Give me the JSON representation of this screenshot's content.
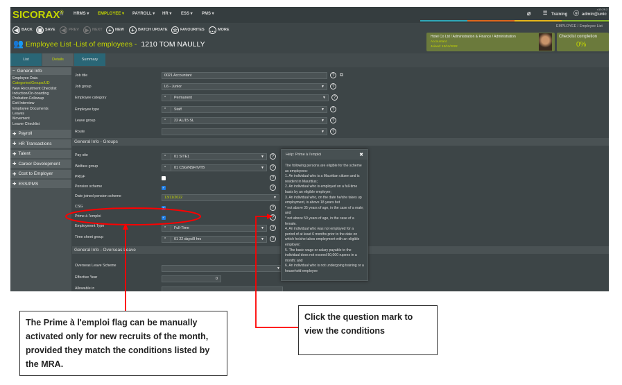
{
  "app": {
    "logo": "SICORAX",
    "version": "v10.29.2",
    "user": "admin@unic",
    "training": "Training"
  },
  "nav": [
    "HRMS ▾",
    "EMPLOYEE ▾",
    "PAYROLL ▾",
    "HR ▾",
    "ESS ▾",
    "PMS ▾"
  ],
  "toolbar": {
    "back": "BACK",
    "save": "SAVE",
    "prev": "PREV",
    "next": "NEXT",
    "new": "NEW",
    "batch": "BATCH UPDATE",
    "fav": "FAVOURITES",
    "more": "MORE"
  },
  "breadcrumb": {
    "section": "EMPLOYEE /",
    "page": "Employee List"
  },
  "page_title": "Employee List -List of employees -",
  "employee": "1210 TOM NAULLY",
  "card": {
    "org": "Hotel Co Ltd / Administration & Finance / Administration",
    "position": "Accountant",
    "joined": "Joined: 13/11/2022",
    "checklist_label": "Checklist completion",
    "checklist_value": "0%"
  },
  "stripe_colors": [
    "#2fa8b8",
    "#e0661c",
    "#e8b81a",
    "#8cba2a"
  ],
  "tabs": [
    "List",
    "Details",
    "Summary"
  ],
  "sidebar": {
    "general": "General Info",
    "items": [
      "Employee Data",
      "Categories/Groups/UD",
      "New Recruitment Checklist",
      "Induction/On-boarding",
      "Probation Followup",
      "Exit Interview",
      "Employee Documents",
      "Leaves",
      "Movement",
      "Leaver Checklist"
    ],
    "groups": [
      "Payroll",
      "HR Transactions",
      "Talent",
      "Career Development",
      "Cost to Employer",
      "ESS/PMS"
    ]
  },
  "form": {
    "rows1": [
      {
        "label": "Job title",
        "value": "0021 Accountant"
      },
      {
        "label": "Job group",
        "value": "L6 - Junior"
      },
      {
        "label": "Employee category",
        "value": "Permanent"
      },
      {
        "label": "Employee type",
        "value": "Staff"
      },
      {
        "label": "Leave group",
        "value": "22 AL/15 SL"
      },
      {
        "label": "Route",
        "value": ""
      }
    ],
    "section_groups": "General Info - Groups",
    "pay_site": {
      "label": "Pay site",
      "value": "01 SITE1"
    },
    "welfare": {
      "label": "Welfare group",
      "value": "01 CSG/NSF/IVTB"
    },
    "prgf": {
      "label": "PRGF",
      "checked": false
    },
    "pension": {
      "label": "Pension scheme",
      "checked": true
    },
    "date_pension": {
      "label": "Date joined pension scheme",
      "value": "13/11/2022"
    },
    "csg": {
      "label": "CSG",
      "checked": true
    },
    "prime": {
      "label": "Prime à l'emploi",
      "checked": true
    },
    "emp_type": {
      "label": "Employment Type",
      "value": "Full-Time"
    },
    "timesheet": {
      "label": "Time sheet group",
      "value": "01 22 days/8 hrs"
    },
    "section_overseas": "General Info - Overseas Leave",
    "overseas": {
      "label": "Overseas Leave Scheme",
      "value": ""
    },
    "eff_year": {
      "label": "Effective Year",
      "value": "0"
    },
    "allowable": {
      "label": "Allowable in",
      "value": ""
    }
  },
  "help": {
    "title": "Help: Prime à l'emploi",
    "body": "The following persons are eligible for the scheme as employees:\n1. An individual who is a Mauritian citizen and is resident in Mauritius;\n2. An individual who is employed on a full-time basis by an eligible employer;\n3. An individual who, on the date he/she takes up employment, is above 18 years but\n* not above 35 years of age, in the case of a male; and\n* not above 50 years of age, in the case of a female.\n4. An individual who was not employed for a period of at least 6 months prior to the date on which he/she takes employment with an eligible employer;\n5. The basic wage or salary payable to the individual does not exceed 50,000 rupees in a month; and\n6. An individual who is not undergoing training or a household employee"
  },
  "callouts": {
    "left": "The Prime à l'emploi flag can be manually activated only for new recruits of the month, provided they match the conditions listed by the MRA.",
    "right": "Click the question mark to view the conditions"
  },
  "colors": {
    "accent": "#c4d600",
    "annotation": "#ff0000"
  }
}
